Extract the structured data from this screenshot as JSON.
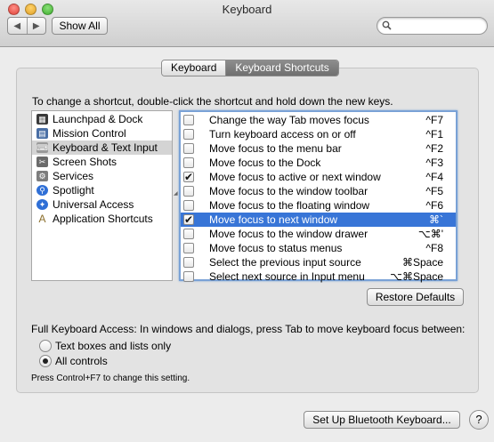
{
  "window": {
    "title": "Keyboard"
  },
  "toolbar": {
    "back": "◀",
    "forward": "▶",
    "show_all": "Show All",
    "search_placeholder": ""
  },
  "tabs": [
    {
      "label": "Keyboard",
      "active": false
    },
    {
      "label": "Keyboard Shortcuts",
      "active": true
    }
  ],
  "instructions": "To change a shortcut, double-click the shortcut and hold down the new keys.",
  "categories": [
    {
      "label": "Launchpad & Dock",
      "icon": "launchpad-icon"
    },
    {
      "label": "Mission Control",
      "icon": "mission-control-icon"
    },
    {
      "label": "Keyboard & Text Input",
      "icon": "keyboard-icon",
      "selected": true
    },
    {
      "label": "Screen Shots",
      "icon": "screenshot-icon"
    },
    {
      "label": "Services",
      "icon": "gear-icon"
    },
    {
      "label": "Spotlight",
      "icon": "spotlight-icon"
    },
    {
      "label": "Universal Access",
      "icon": "accessibility-icon"
    },
    {
      "label": "Application Shortcuts",
      "icon": "app-store-icon"
    }
  ],
  "shortcuts": [
    {
      "label": "Change the way Tab moves focus",
      "key": "^F7",
      "checked": false
    },
    {
      "label": "Turn keyboard access on or off",
      "key": "^F1",
      "checked": false
    },
    {
      "label": "Move focus to the menu bar",
      "key": "^F2",
      "checked": false
    },
    {
      "label": "Move focus to the Dock",
      "key": "^F3",
      "checked": false
    },
    {
      "label": "Move focus to active or next window",
      "key": "^F4",
      "checked": true
    },
    {
      "label": "Move focus to the window toolbar",
      "key": "^F5",
      "checked": false
    },
    {
      "label": "Move focus to the floating window",
      "key": "^F6",
      "checked": false
    },
    {
      "label": "Move focus to next window",
      "key": "⌘`",
      "checked": true,
      "selected": true
    },
    {
      "label": "Move focus to the window drawer",
      "key": "⌥⌘'",
      "checked": false
    },
    {
      "label": "Move focus to status menus",
      "key": "^F8",
      "checked": false
    },
    {
      "label": "Select the previous input source",
      "key": "⌘Space",
      "checked": false
    },
    {
      "label": "Select next source in Input menu",
      "key": "⌥⌘Space",
      "checked": false
    }
  ],
  "restore_defaults": "Restore Defaults",
  "full_keyboard_access": {
    "label": "Full Keyboard Access: In windows and dialogs, press Tab to move keyboard focus between:",
    "options": [
      {
        "label": "Text boxes and lists only",
        "selected": false
      },
      {
        "label": "All controls",
        "selected": true
      }
    ],
    "note": "Press Control+F7 to change this setting."
  },
  "bluetooth_button": "Set Up Bluetooth Keyboard...",
  "help_button": "?",
  "colors": {
    "selection": "#3875d7",
    "focus_ring": "#7aa2d6"
  }
}
